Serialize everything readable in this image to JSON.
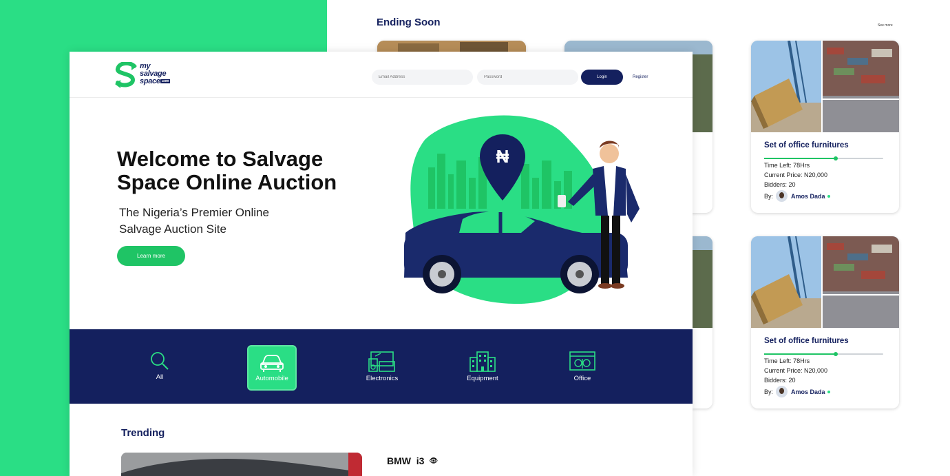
{
  "ending_soon": {
    "title": "Ending Soon",
    "see_more": "See more",
    "cards": [
      {
        "title": "Set of office furnitures",
        "progress": 0.6,
        "time_left": "Time Left: 78Hrs",
        "current_price": "Current Price: N20,000",
        "bidders": "Bidders: 20",
        "by_label": "By:",
        "seller": "Amos Dada"
      },
      {
        "title": "Set of office furnitures",
        "progress": 0.6,
        "time_left": "Time Left: 78Hrs",
        "current_price": "Current Price: N20,000",
        "bidders": "Bidders: 20",
        "by_label": "By:",
        "seller": "Amos Dada"
      }
    ]
  },
  "header": {
    "logo": {
      "line1": "my",
      "line2": "salvage",
      "line3": "space",
      "suffix": ".com"
    },
    "email_placeholder": "Email Address",
    "password_placeholder": "Password",
    "login_label": "Login",
    "register_label": "Register"
  },
  "hero": {
    "title": "Welcome to Salvage Space Online Auction",
    "subtitle": "The Nigeria’s Premier Online Salvage Auction Site",
    "cta_label": "Learn more",
    "pin_symbol": "₦"
  },
  "categories": [
    {
      "label": "All",
      "icon": "search-icon",
      "active": false
    },
    {
      "label": "Automobile",
      "icon": "car-icon",
      "active": true
    },
    {
      "label": "Electronics",
      "icon": "electronics-icon",
      "active": false
    },
    {
      "label": "Equipment",
      "icon": "building-icon",
      "active": false
    },
    {
      "label": "Office",
      "icon": "office-icon",
      "active": false
    }
  ],
  "trending": {
    "title": "Trending",
    "item_name": "BMW  i3",
    "item_icon": "eye-icon"
  },
  "colors": {
    "brand_green": "#2ade85",
    "button_green": "#1fc465",
    "navy": "#14205e"
  }
}
